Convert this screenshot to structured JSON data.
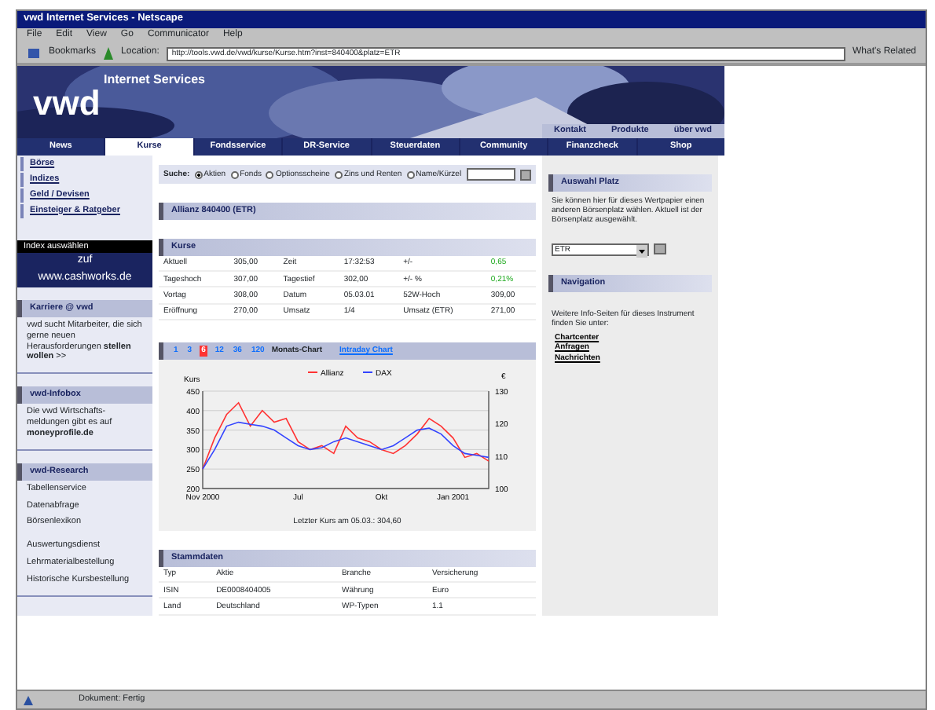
{
  "window": {
    "title": "vwd Internet Services - Netscape"
  },
  "menu": [
    "File",
    "Edit",
    "View",
    "Go",
    "Communicator",
    "Help"
  ],
  "toolbar": {
    "bookmarks": "Bookmarks",
    "location_label": "Location:",
    "url": "http://tools.vwd.de/vwd/kurse/Kurse.htm?inst=840400&platz=ETR",
    "related": "What's Related"
  },
  "banner": {
    "subtitle": "Internet Services",
    "brand": "vwd",
    "links": [
      "Kontakt",
      "Produkte",
      "über vwd"
    ]
  },
  "nav": [
    {
      "label": "News",
      "selected": false
    },
    {
      "label": "Kurse",
      "selected": true
    },
    {
      "label": "Fondsservice",
      "selected": false
    },
    {
      "label": "DR-Service",
      "selected": false
    },
    {
      "label": "Steuerdaten",
      "selected": false
    },
    {
      "label": "Community",
      "selected": false
    },
    {
      "label": "Finanzcheck",
      "selected": false
    },
    {
      "label": "Shop",
      "selected": false
    }
  ],
  "sidebar": {
    "items": [
      "Börse",
      "Indizes",
      "Geld / Devisen",
      "Einsteiger & Ratgeber"
    ],
    "ad": {
      "label": "Index auswählen",
      "line_1": "zuf",
      "line_2": "www.cashworks.de"
    },
    "panels": [
      {
        "title": "Karriere @ vwd",
        "groups": [
          [
            "vwd sucht Mitarbeiter, die sich gerne neuen Herausforderungen **stellen wollen** >>"
          ]
        ]
      },
      {
        "title": "vwd-Infobox",
        "groups": [
          [
            "Die vwd Wirtschafts-meldungen gibt es auf **moneyprofile.de**"
          ]
        ]
      },
      {
        "title": "vwd-Research",
        "groups": [
          [
            "Tabellenservice",
            "Datenabfrage",
            "Börsenlexikon"
          ],
          [
            "Auswertungsdienst",
            "Lehrmaterialbestellung",
            "Historische Kursbestellung"
          ]
        ]
      }
    ]
  },
  "search": {
    "label": "Suche:",
    "options": [
      {
        "label": "Aktien",
        "selected": true
      },
      {
        "label": "Fonds",
        "selected": false
      },
      {
        "label": "Optionsscheine",
        "selected": false
      },
      {
        "label": "Zins und Renten",
        "selected": false
      },
      {
        "label": "Name/Kürzel",
        "selected": false
      }
    ]
  },
  "instrument": {
    "title": "Allianz 840400 (ETR)"
  },
  "quotes": {
    "title": "Kurse",
    "rows": [
      {
        "cells": [
          "Aktuell",
          "305,00",
          "Zeit",
          "17:32:53",
          "+/-",
          "0,65"
        ],
        "positive": true
      },
      {
        "cells": [
          "Tageshoch",
          "307,00",
          "Tagestief",
          "302,00",
          "+/- %",
          "0,21%"
        ],
        "positive": true
      },
      {
        "cells": [
          "Vortag",
          "308,00",
          "Datum",
          "05.03.01",
          "52W-Hoch",
          "309,00"
        ],
        "positive": false
      },
      {
        "cells": [
          "Eröffnung",
          "270,00",
          "Umsatz",
          "1/4",
          "Umsatz (ETR)",
          "271,00"
        ],
        "positive": false
      }
    ]
  },
  "chart": {
    "periods": [
      {
        "label": "1",
        "selected": false
      },
      {
        "label": "3",
        "selected": false
      },
      {
        "label": "6",
        "selected": true
      },
      {
        "label": "12",
        "selected": false
      },
      {
        "label": "36",
        "selected": false
      },
      {
        "label": "120",
        "selected": false
      }
    ],
    "tab_1": "Monats-Chart",
    "tab_2": "Intraday Chart",
    "right_axis_unit": "€",
    "right_axis_labels": [
      "130",
      "120",
      "110",
      "100"
    ],
    "chart_data": {
      "type": "line",
      "ylabel": "Kurs",
      "grid": true,
      "legend": "top",
      "categories": [
        "Nov 2000",
        null,
        null,
        null,
        null,
        null,
        null,
        null,
        "Jul",
        null,
        null,
        null,
        null,
        null,
        null,
        "Okt",
        null,
        null,
        null,
        null,
        null,
        "Jan 2001",
        null,
        null,
        null
      ],
      "ylim": [
        200,
        450
      ],
      "yticks": [
        200,
        250,
        300,
        350,
        400,
        450
      ],
      "series": [
        {
          "name": "Allianz",
          "color": "#ff3333",
          "values": [
            250,
            330,
            390,
            420,
            360,
            400,
            370,
            380,
            320,
            300,
            310,
            290,
            360,
            330,
            320,
            300,
            290,
            310,
            340,
            380,
            360,
            330,
            280,
            290,
            270
          ]
        },
        {
          "name": "DAX",
          "color": "#3344ff",
          "values": [
            250,
            300,
            360,
            370,
            365,
            360,
            350,
            330,
            310,
            300,
            305,
            320,
            330,
            320,
            310,
            300,
            310,
            330,
            350,
            355,
            340,
            310,
            290,
            285,
            280
          ]
        }
      ]
    },
    "caption": "Letzter Kurs am 05.03.: 304,60"
  },
  "master_data": {
    "title": "Stammdaten",
    "rows": [
      [
        "Typ",
        "Aktie",
        "Branche",
        "Versicherung"
      ],
      [
        "ISIN",
        "DE0008404005",
        "Währung",
        "Euro"
      ],
      [
        "Land",
        "Deutschland",
        "WP-Typen",
        "1.1"
      ]
    ]
  },
  "exchange": {
    "title": "Auswahl Platz",
    "text": "Sie können hier für dieses Wertpapier einen anderen Börsenplatz wählen. Aktuell ist der Börsenplatz ausgewählt.",
    "value": "ETR"
  },
  "navigation": {
    "title": "Navigation",
    "text": "Weitere Info-Seiten für dieses Instrument finden Sie unter:",
    "links": [
      "Chartcenter",
      "Anfragen",
      "Nachrichten"
    ]
  },
  "status_bar": "Dokument: Fertig"
}
